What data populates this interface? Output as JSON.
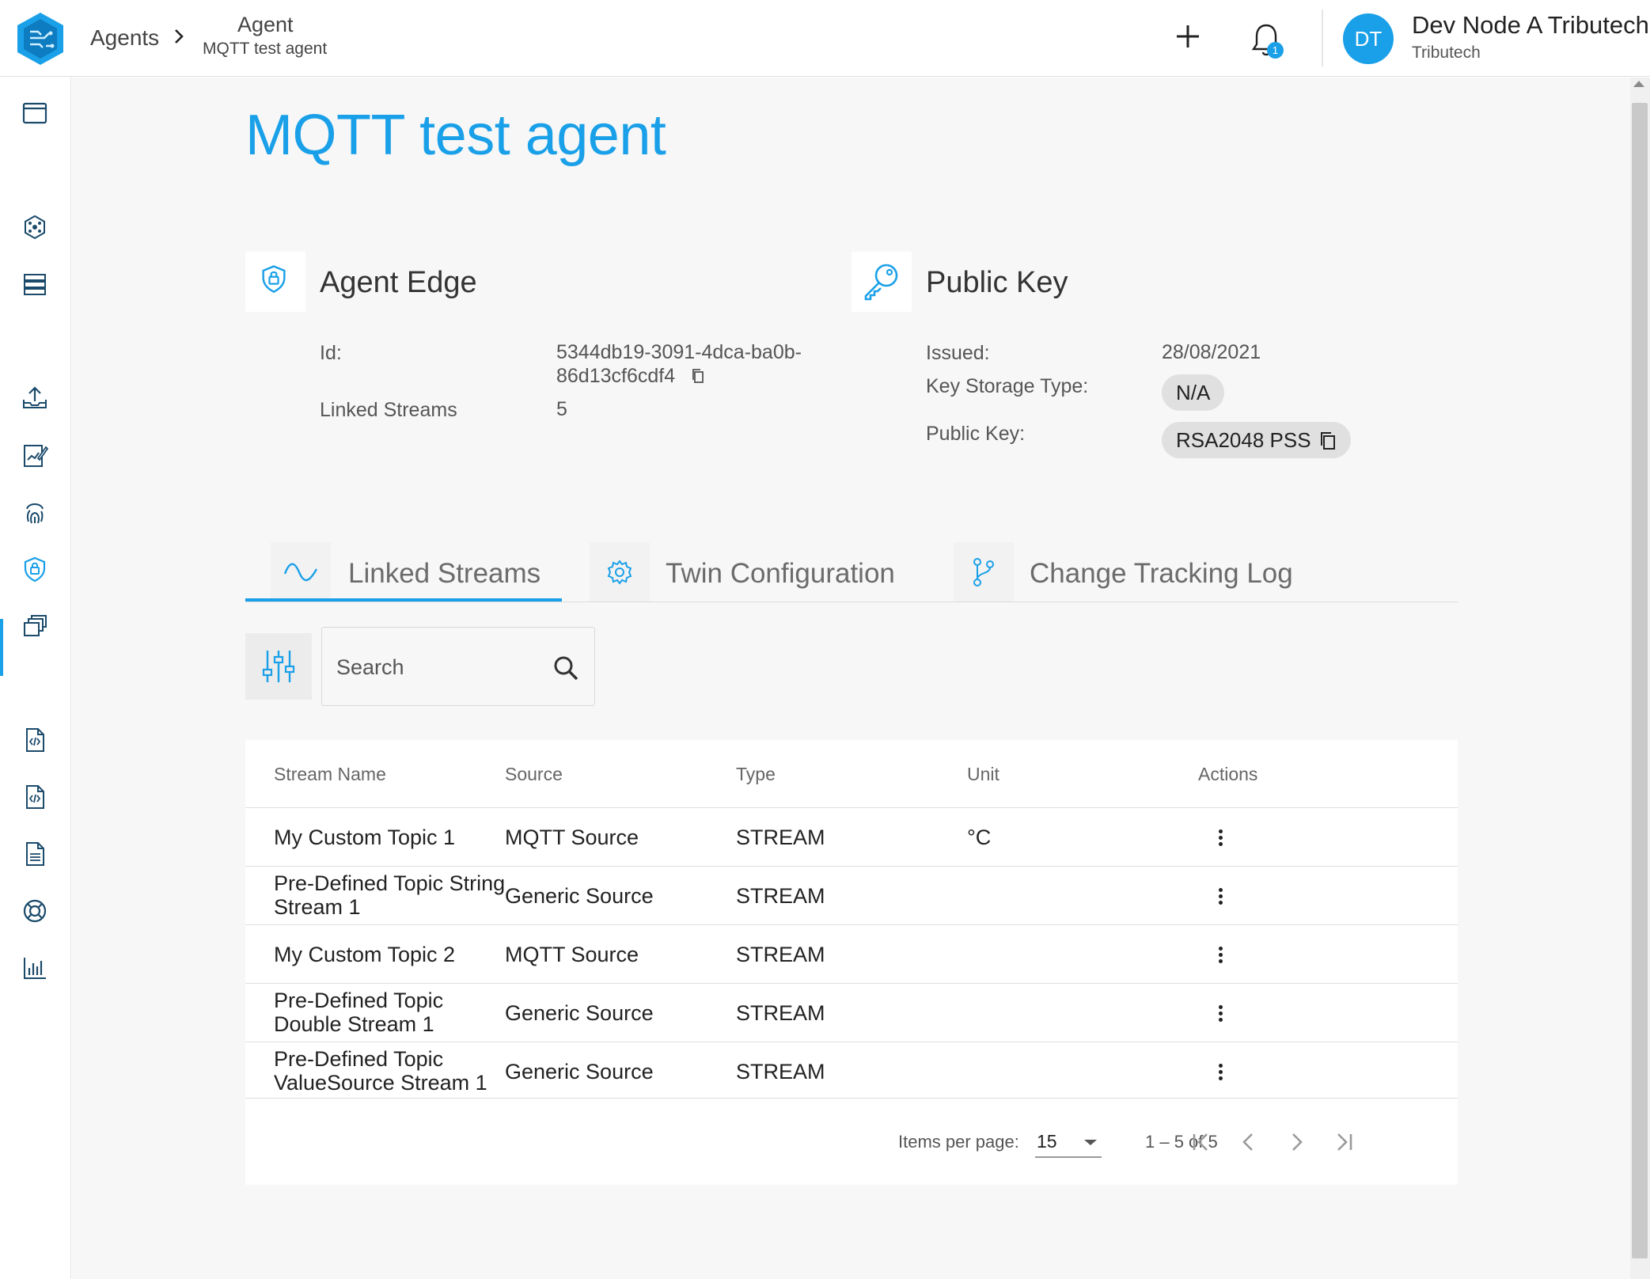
{
  "header": {
    "breadcrumb_root": "Agents",
    "breadcrumb_title": "Agent",
    "breadcrumb_subtitle": "MQTT test agent",
    "notification_count": "1",
    "user_initials": "DT",
    "user_name": "Dev Node A Tributech",
    "user_org": "Tributech"
  },
  "sidebar": {
    "active_item": "agents",
    "icons": [
      "window-icon",
      "network-icon",
      "database-icon",
      "upload-icon",
      "edit-chart-icon",
      "fingerprint-icon",
      "agent-shield-icon",
      "layers-icon",
      "code-file-icon",
      "code-file-icon-2",
      "document-icon",
      "lifebuoy-icon",
      "bar-chart-icon"
    ]
  },
  "page": {
    "title": "MQTT test agent"
  },
  "agent_edge": {
    "heading": "Agent Edge",
    "id_label": "Id:",
    "id_value_line1": "5344db19-3091-4dca-ba0b-",
    "id_value_line2": "86d13cf6cdf4",
    "linked_streams_label": "Linked Streams",
    "linked_streams_value": "5"
  },
  "public_key": {
    "heading": "Public Key",
    "issued_label": "Issued:",
    "issued_value": "28/08/2021",
    "storage_label": "Key Storage Type:",
    "storage_value": "N/A",
    "key_label": "Public Key:",
    "key_value": "RSA2048 PSS"
  },
  "tabs": [
    {
      "label": "Linked Streams",
      "active": true
    },
    {
      "label": "Twin Configuration",
      "active": false
    },
    {
      "label": "Change Tracking Log",
      "active": false
    }
  ],
  "search": {
    "placeholder": "Search",
    "value": ""
  },
  "table": {
    "headers": [
      "Stream Name",
      "Source",
      "Type",
      "Unit",
      "Actions"
    ],
    "rows": [
      {
        "name_l1": "My Custom Topic 1",
        "name_l2": "",
        "source": "MQTT Source",
        "type": "STREAM",
        "unit": "°C"
      },
      {
        "name_l1": "Pre-Defined Topic String",
        "name_l2": "Stream 1",
        "source": "Generic Source",
        "type": "STREAM",
        "unit": ""
      },
      {
        "name_l1": "My Custom Topic 2",
        "name_l2": "",
        "source": "MQTT Source",
        "type": "STREAM",
        "unit": ""
      },
      {
        "name_l1": "Pre-Defined Topic",
        "name_l2": "Double Stream 1",
        "source": "Generic Source",
        "type": "STREAM",
        "unit": ""
      },
      {
        "name_l1": "Pre-Defined Topic",
        "name_l2": "ValueSource Stream 1",
        "source": "Generic Source",
        "type": "STREAM",
        "unit": ""
      }
    ]
  },
  "pagination": {
    "items_per_page_label": "Items per page:",
    "items_per_page_value": "15",
    "range": "1 – 5 of 5"
  },
  "colors": {
    "accent": "#1aa0e8",
    "background": "#f7f7f7",
    "chip": "#e0e0e0"
  }
}
